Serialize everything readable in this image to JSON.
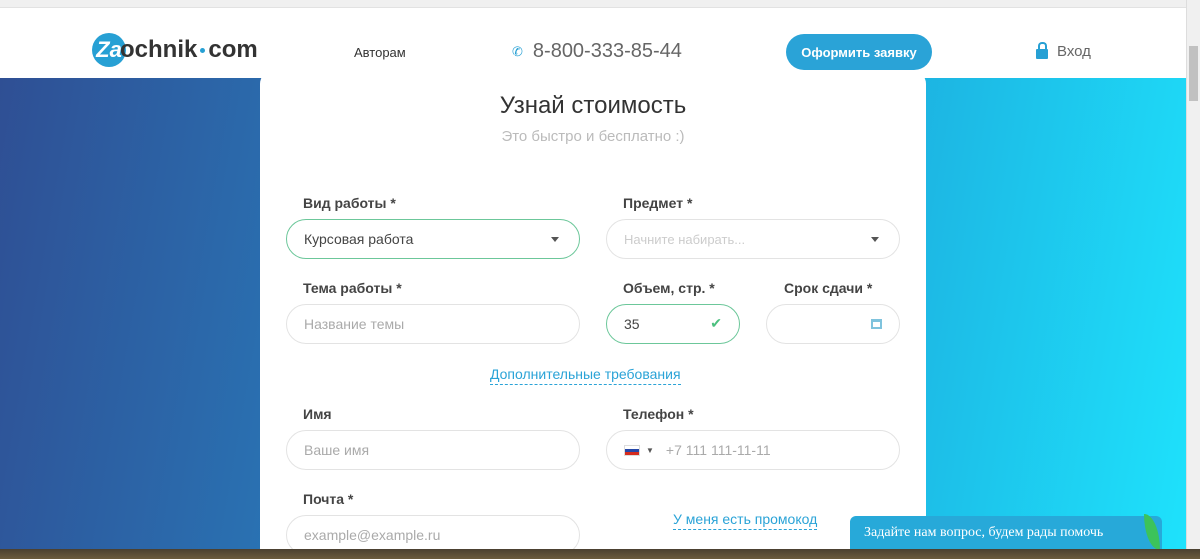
{
  "header": {
    "logo_badge": "Za",
    "logo_text": "ochnik",
    "logo_suffix": "com",
    "nav_authors": "Авторам",
    "phone": "8-800-333-85-44",
    "cta": "Оформить заявку",
    "login": "Вход"
  },
  "form": {
    "title": "Узнай стоимость",
    "subtitle": "Это быстро и бесплатно :)",
    "work_type_label": "Вид работы *",
    "work_type_value": "Курсовая работа",
    "subject_label": "Предмет *",
    "subject_placeholder": "Начните набирать...",
    "topic_label": "Тема работы *",
    "topic_placeholder": "Название темы",
    "pages_label": "Объем, стр. *",
    "pages_value": "35",
    "deadline_label": "Срок сдачи *",
    "extra_link": "Дополнительные требования",
    "name_label": "Имя",
    "name_placeholder": "Ваше имя",
    "phone_label": "Телефон *",
    "phone_placeholder": "+7 111 111-11-11",
    "email_label": "Почта *",
    "email_placeholder": "example@example.ru",
    "promo_link": "У меня есть промокод"
  },
  "chat": {
    "text": "Задайте нам вопрос, будем рады помочь"
  }
}
